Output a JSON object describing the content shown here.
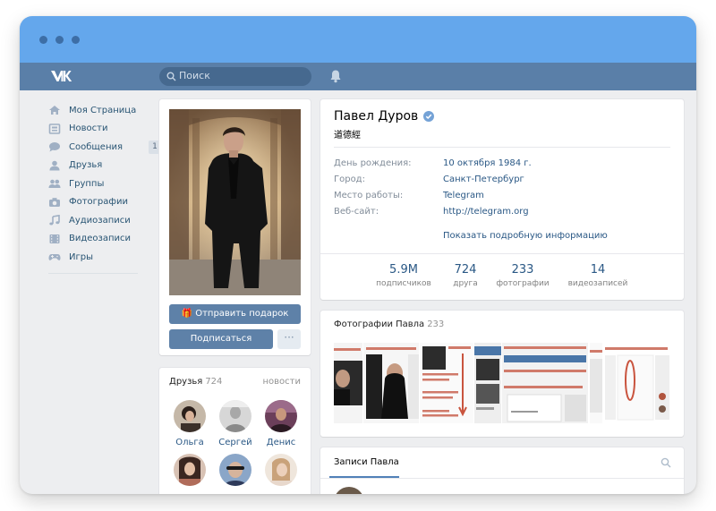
{
  "header": {
    "logo": "vk-logo-icon",
    "search_placeholder": "Поиск"
  },
  "sidebar": {
    "items": [
      {
        "label": "Моя Страница",
        "icon": "home-icon"
      },
      {
        "label": "Новости",
        "icon": "news-icon"
      },
      {
        "label": "Сообщения",
        "icon": "messages-icon",
        "badge": "1"
      },
      {
        "label": "Друзья",
        "icon": "user-icon"
      },
      {
        "label": "Группы",
        "icon": "groups-icon"
      },
      {
        "label": "Фотографии",
        "icon": "camera-icon"
      },
      {
        "label": "Аудиозаписи",
        "icon": "music-icon"
      },
      {
        "label": "Видеозаписи",
        "icon": "video-icon"
      },
      {
        "label": "Игры",
        "icon": "gamepad-icon"
      }
    ]
  },
  "profile": {
    "gift_button": "Отправить подарок",
    "subscribe_button": "Подписаться",
    "more_button": "···",
    "name": "Павел Дуров",
    "status": "道德經",
    "info": [
      {
        "label": "День рождения:",
        "value": "10 октября 1984 г."
      },
      {
        "label": "Город:",
        "value": "Санкт-Петербург"
      },
      {
        "label": "Место работы:",
        "value": "Telegram"
      },
      {
        "label": "Веб-сайт:",
        "value": "http://telegram.org"
      }
    ],
    "show_more": "Показать подробную информацию",
    "stats": [
      {
        "value": "5.9M",
        "label": "подписчиков"
      },
      {
        "value": "724",
        "label": "друга"
      },
      {
        "value": "233",
        "label": "фотографии"
      },
      {
        "value": "14",
        "label": "видеозаписей"
      }
    ]
  },
  "friends": {
    "title": "Друзья",
    "count": "724",
    "news_link": "новости",
    "items": [
      {
        "name": "Ольга"
      },
      {
        "name": "Сергей"
      },
      {
        "name": "Денис"
      },
      {
        "name": ""
      },
      {
        "name": ""
      },
      {
        "name": ""
      }
    ]
  },
  "photos": {
    "title": "Фотографии Павла",
    "count": "233"
  },
  "posts": {
    "tab": "Записи Павла"
  },
  "colors": {
    "titlebar": "#64a7ec",
    "header": "#5a7fa8",
    "accent_button": "#5e81a8",
    "link": "#2a5885"
  }
}
